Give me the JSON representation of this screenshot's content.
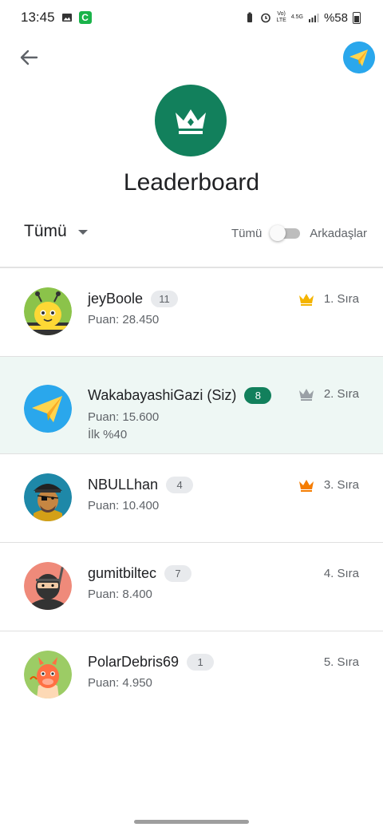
{
  "status_bar": {
    "time": "13:45",
    "app_letter": "C",
    "carrier_top": "Vo)",
    "carrier_bottom": "LTE",
    "network": "4.5G",
    "battery": "%58"
  },
  "header": {
    "title": "Leaderboard"
  },
  "filters": {
    "dropdown_value": "Tümü",
    "toggle_left": "Tümü",
    "toggle_right": "Arkadaşlar",
    "toggle_on": false
  },
  "colors": {
    "accent_green": "#12805c",
    "highlight_bg": "#eef7f4",
    "gold": "#f4b400",
    "silver": "#9aa0a6",
    "bronze": "#f57c00"
  },
  "leaderboard": [
    {
      "name": "jeyBoole",
      "level": "11",
      "score": "Puan: 28.450",
      "rank": "1. Sıra",
      "crown": "gold",
      "avatar": "bee-avatar"
    },
    {
      "name": "WakabayashiGazi (Siz)",
      "level": "8",
      "score": "Puan: 15.600",
      "extra": "İlk %40",
      "rank": "2. Sıra",
      "crown": "silver",
      "avatar": "paper-plane-avatar",
      "is_current_user": true
    },
    {
      "name": "NBULLhan",
      "level": "4",
      "score": "Puan: 10.400",
      "rank": "3. Sıra",
      "crown": "bronze",
      "avatar": "pirate-avatar"
    },
    {
      "name": "gumitbiltec",
      "level": "7",
      "score": "Puan: 8.400",
      "rank": "4. Sıra",
      "avatar": "ninja-avatar"
    },
    {
      "name": "PolarDebris69",
      "level": "1",
      "score": "Puan: 4.950",
      "rank": "5. Sıra",
      "avatar": "dragon-avatar"
    }
  ]
}
